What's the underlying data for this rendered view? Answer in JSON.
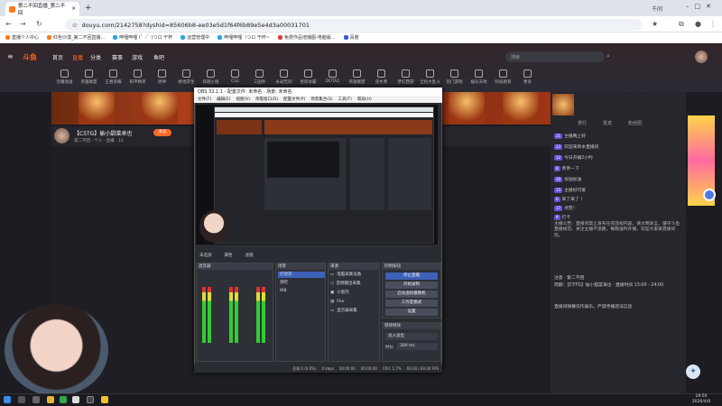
{
  "browser": {
    "tab_title": "第二不回直播_第二不回",
    "url": "douyu.com/2142758?dyshid=85606b8-ee03e5d1f64f6b89e5e4d3a00031701",
    "bookmarks": [
      "直播个人中心",
      "红色沙漠_第二不回直播...",
      "哔哩哔哩 (゜-゜)つロ 干杯",
      "运营管理中",
      "哔哩哔哩（つロ 干杯~",
      "免费作品增播图-电脑版...",
      "百度"
    ],
    "profile_label": "千问"
  },
  "site": {
    "logo": "斗鱼",
    "nav": [
      "首页",
      "直播",
      "分类",
      "赛事",
      "游戏",
      "鱼吧"
    ],
    "search_placeholder": "搜索",
    "categories": [
      "云播放送",
      "英雄联盟",
      "王者荣耀",
      "和平精英",
      "原神",
      "绝地求生",
      "穿越火线",
      "CS2",
      "三国杀",
      "永劫无间",
      "星际争霸",
      "DOTA2",
      "英雄联盟",
      "逆水寒",
      "梦幻西游",
      "全民大乱斗",
      "热门游戏",
      "娱乐天地",
      "科技教育",
      "更多"
    ]
  },
  "stream": {
    "title": "【C5TG】偷小甜菜来也",
    "sub": "第二不回  ·  个人  ·  直播  ·  13",
    "follow_label": "关注",
    "viewer_label": "人气"
  },
  "obs": {
    "title": "OBS 32.1.1 - 配置文件: 未命名 - 场景: 未命名",
    "menu": [
      "文件(F)",
      "编辑(E)",
      "视图(V)",
      "停靠窗口(D)",
      "配置文件(P)",
      "场景集合(S)",
      "工具(T)",
      "帮助(H)"
    ],
    "tabs": [
      "未选源",
      "属性",
      "滤镜"
    ],
    "docks": {
      "mixer": "混音器",
      "scenes": "场景",
      "sources": "来源",
      "controls": "控制按钮",
      "transitions": "转场特效"
    },
    "scenes": [
      "打架壳",
      "测控",
      "WB"
    ],
    "sources": [
      "电脑采集设备",
      "音频输出采集",
      "小窗壳",
      "Flur",
      "显示器采集"
    ],
    "controls": [
      "停止直播",
      "开始录制",
      "启动虚拟摄像机",
      "工作室模式",
      "设置"
    ],
    "transition_value": "淡入淡出",
    "duration_label": "时长",
    "duration_value": "300 ms",
    "status": [
      "丢帧 0 (0.0%)",
      "0 kbps",
      "00:00:00",
      "00:00:00",
      "CPU: 1.7%",
      "60.00 / 60.00 FPS"
    ]
  },
  "chat": {
    "tabs": [
      "排行",
      "贵宾",
      "粉丝团"
    ],
    "messages": [
      {
        "lvl": "23",
        "text": "欢迎来到本直播间"
      },
      {
        "lvl": "12",
        "text": "今日开播2小时"
      },
      {
        "lvl": "8",
        "text": "亲亲一下"
      },
      {
        "lvl": "30",
        "text": "加油加油"
      },
      {
        "lvl": "15",
        "text": "主播好可爱"
      },
      {
        "lvl": "6",
        "text": "来了来了 ！"
      },
      {
        "lvl": "17",
        "text": "点赞！"
      },
      {
        "lvl": "9",
        "text": "打卡"
      },
      {
        "lvl": "21",
        "text": "主播晚上好"
      }
    ],
    "announcement": "主播公告：直播间禁止发布任何违规内容，请文明发言，遵守斗鱼直播规范。关注主播不迷路，每晚准时开播，欢迎大家来直播间玩。",
    "schedule_title": "注意 · 第二不回",
    "schedule": "周期：【C5TG】偷小甜菜来也 · 直播时间 13:00 - 24:00",
    "footer_note": "直播间弹幕仅作娱乐，严禁传播违法信息"
  },
  "taskbar": {
    "time": "19:50",
    "date": "2026/4/8"
  }
}
